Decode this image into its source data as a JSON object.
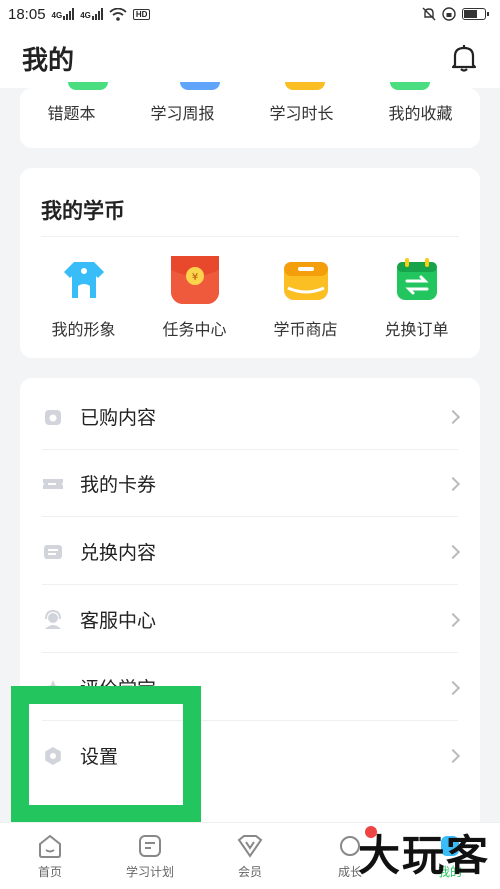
{
  "status": {
    "time": "18:05",
    "net1": "4G",
    "net2": "4G",
    "hd": "HD"
  },
  "header": {
    "title": "我的"
  },
  "quick": {
    "items": [
      "错题本",
      "学习周报",
      "学习时长",
      "我的收藏"
    ]
  },
  "coins": {
    "title": "我的学币",
    "items": [
      {
        "label": "我的形象",
        "icon": "avatar-shirt-icon"
      },
      {
        "label": "任务中心",
        "icon": "red-envelope-icon"
      },
      {
        "label": "学币商店",
        "icon": "shop-icon"
      },
      {
        "label": "兑换订单",
        "icon": "exchange-calendar-icon"
      }
    ]
  },
  "menu": {
    "items": [
      {
        "label": "已购内容",
        "icon": "purchased-icon"
      },
      {
        "label": "我的卡券",
        "icon": "coupon-icon"
      },
      {
        "label": "兑换内容",
        "icon": "redeem-list-icon"
      },
      {
        "label": "客服中心",
        "icon": "customer-service-icon"
      },
      {
        "label": "评价学宝",
        "icon": "rate-icon"
      },
      {
        "label": "设置",
        "icon": "settings-gear-icon"
      }
    ]
  },
  "tabs": [
    "首页",
    "学习计划",
    "会员",
    "成长",
    "我的"
  ],
  "watermark": "大玩客",
  "colors": {
    "highlight": "#22c55e",
    "accent_green": "#22c55e"
  }
}
